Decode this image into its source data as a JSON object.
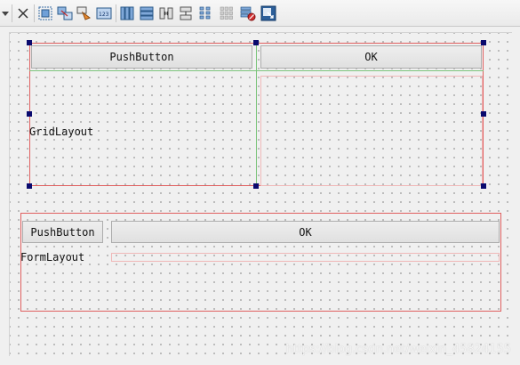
{
  "toolbar": {
    "icons": [
      "chevron-down-icon",
      "close-icon",
      "edit-widgets-icon",
      "edit-signals-slots-icon",
      "edit-buddies-icon",
      "edit-tab-order-icon",
      "layout-horizontal-icon",
      "layout-vertical-icon",
      "layout-horizontal-splitter-icon",
      "layout-vertical-splitter-icon",
      "layout-form-icon",
      "layout-grid-icon",
      "break-layout-icon",
      "adjust-size-icon"
    ]
  },
  "grid_layout": {
    "label": "GridLayout",
    "button1": "PushButton",
    "button2": "OK"
  },
  "form_layout": {
    "label": "FormLayout",
    "button1": "PushButton",
    "button2": "OK"
  },
  "watermark": "https://blog.csdn.net/weixin_45824155"
}
